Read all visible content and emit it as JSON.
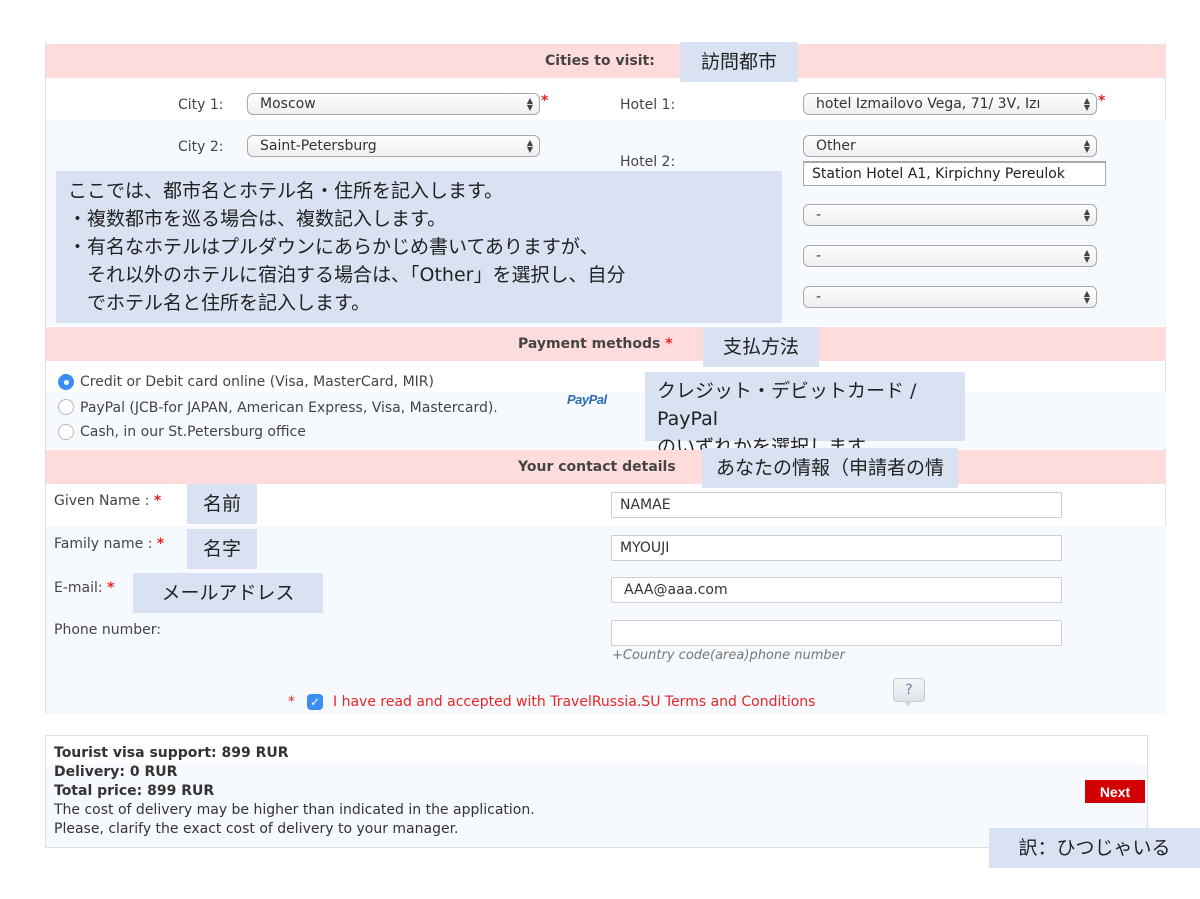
{
  "cities_section": {
    "title": "Cities to visit:",
    "note": "訪問都市",
    "city1": {
      "label": "City 1:",
      "value": "Moscow"
    },
    "city2": {
      "label": "City 2:",
      "value": "Saint-Petersburg"
    },
    "hotel1": {
      "label": "Hotel 1:",
      "value": "hotel Izmailovo Vega, 71/ 3V, Izı"
    },
    "hotel2": {
      "label": "Hotel 2:",
      "value": "Other",
      "custom_value": "Station Hotel A1, Kirpichny Pereulok"
    },
    "extra_hotels": [
      "-",
      "-",
      "-"
    ],
    "required_mark": "*",
    "instruction_note": [
      "ここでは、都市名とホテル名・住所を記入します。",
      "・複数都市を巡る場合は、複数記入します。",
      "・有名なホテルはプルダウンにあらかじめ書いてありますが、",
      "　それ以外のホテルに宿泊する場合は、「Other」を選択し、自分",
      "　でホテル名と住所を記入します。"
    ]
  },
  "payment_section": {
    "title": "Payment methods",
    "required_mark": "*",
    "note": "支払方法",
    "options": [
      {
        "label": "Credit or Debit card online (Visa, MasterCard, MIR)",
        "selected": true
      },
      {
        "label": "PayPal (JCB-for JAPAN, American Express, Visa, Mastercard).",
        "selected": false
      },
      {
        "label": "Cash, in our St.Petersburg office",
        "selected": false
      }
    ],
    "paypal_logo": "PayPal",
    "instruction_note": [
      "クレジット・デビットカード / PayPal",
      "のいずれかを選択します。"
    ]
  },
  "contact_section": {
    "title": "Your contact details",
    "note": "あなたの情報（申請者の情報）",
    "given_name": {
      "label": "Given Name :",
      "note": "名前",
      "value": "NAMAE"
    },
    "family_name": {
      "label": "Family name :",
      "note": "名字",
      "value": "MYOUJI"
    },
    "email": {
      "label": "E-mail:",
      "note": "メールアドレス",
      "value": "AAA@aaa.com"
    },
    "phone": {
      "label": "Phone number:",
      "value": "",
      "hint": "+Country code(area)phone number"
    },
    "required_mark": "*",
    "terms": {
      "label": "I have read and accepted with TravelRussia.SU Terms and Conditions",
      "checked": true,
      "help_icon": "?"
    }
  },
  "summary": {
    "lines_bold": [
      "Tourist visa support: 899 RUR",
      "Delivery: 0 RUR",
      "Total price: 899 RUR"
    ],
    "lines": [
      "The cost of delivery may be higher than indicated in the application.",
      "Please, clarify the exact cost of delivery to your manager."
    ],
    "next_label": "Next"
  },
  "translator_credit": "訳：ひつじゃいる",
  "colors": {
    "band": "#ffdcdc",
    "note": "#d9e2f2",
    "accent": "#3c8df5",
    "next": "#d20000",
    "required": "#e82424"
  }
}
